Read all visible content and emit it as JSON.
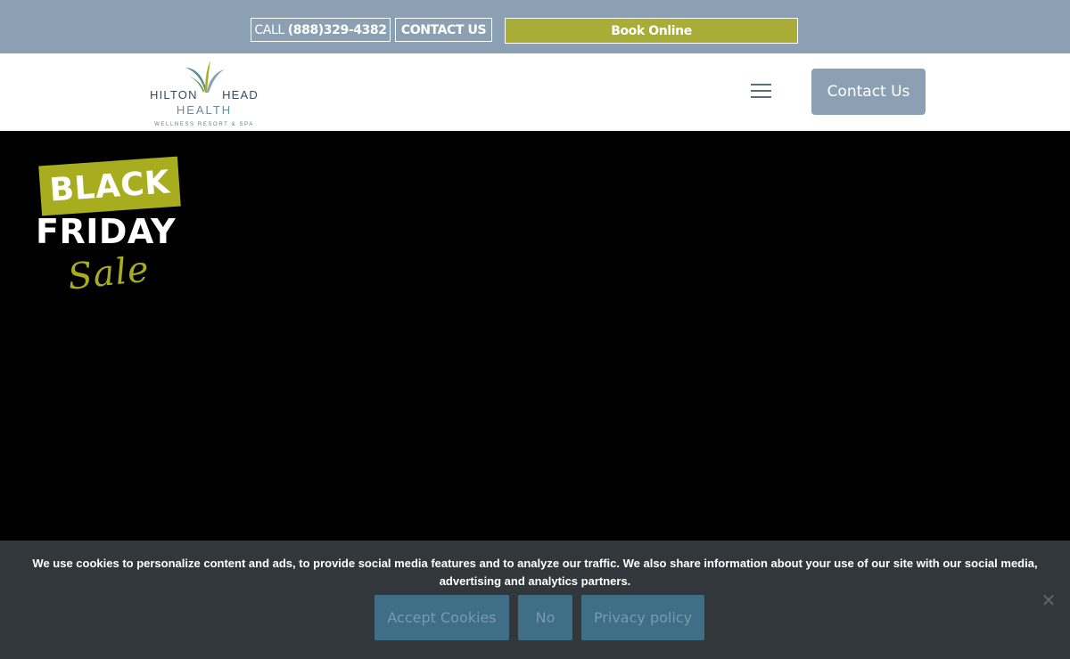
{
  "topbar": {
    "call_prefix": "CALL",
    "phone": "(888)329-4382",
    "contact_label": "CONTACT US",
    "book_label": "Book Online"
  },
  "header": {
    "logo": {
      "line1_left": "HILTON",
      "line1_right": "HEAD",
      "line2": "HEALTH",
      "line3": "WELLNESS RESORT & SPA"
    },
    "menu_icon": "hamburger-icon",
    "contact_button": "Contact Us"
  },
  "hero": {
    "badge_black": "BLACK",
    "badge_friday": "FRIDAY",
    "badge_sale": "Sale"
  },
  "cookie_banner": {
    "text": "We use cookies to personalize content and ads, to provide social media features and to analyze our traffic. We also share information about your use of our site with our social media, advertising and analytics partners.",
    "accept_label": "Accept Cookies",
    "no_label": "No",
    "privacy_label": "Privacy policy",
    "close_icon": "close-icon"
  },
  "colors": {
    "topbar_bg": "#8ba1b3",
    "accent_green": "#a7ad36",
    "cookie_bg": "#32373c",
    "cookie_button_bg": "#3f6f86"
  }
}
